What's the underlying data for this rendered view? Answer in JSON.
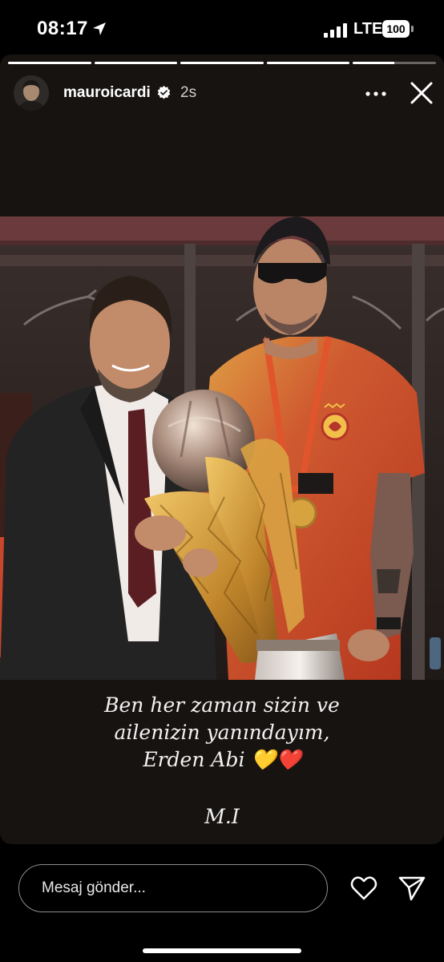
{
  "status_bar": {
    "time": "08:17",
    "network": "LTE",
    "battery": "100",
    "icons": [
      "location-arrow-icon",
      "signal-icon",
      "battery-icon"
    ]
  },
  "story": {
    "segments": [
      {
        "progress": 1
      },
      {
        "progress": 1
      },
      {
        "progress": 1
      },
      {
        "progress": 1
      },
      {
        "progress": 0.5
      }
    ],
    "header": {
      "username": "mauroicardi",
      "verified": true,
      "time_ago": "2s",
      "icons": [
        "verified-badge-icon",
        "more-icon",
        "close-icon"
      ]
    },
    "caption": {
      "lines": [
        "Ben her zaman sizin ve",
        "ailenizin yanındayım,",
        "Erden Abi 💛❤️"
      ],
      "signature": "M.I"
    }
  },
  "bottom_bar": {
    "message_placeholder": "Mesaj gönder...",
    "icons": [
      "heart-icon",
      "send-icon"
    ]
  },
  "colors": {
    "background": "#000000",
    "story_background": "#171311",
    "jersey": "#c8472c",
    "trophy_gold": "#c99a3a"
  }
}
